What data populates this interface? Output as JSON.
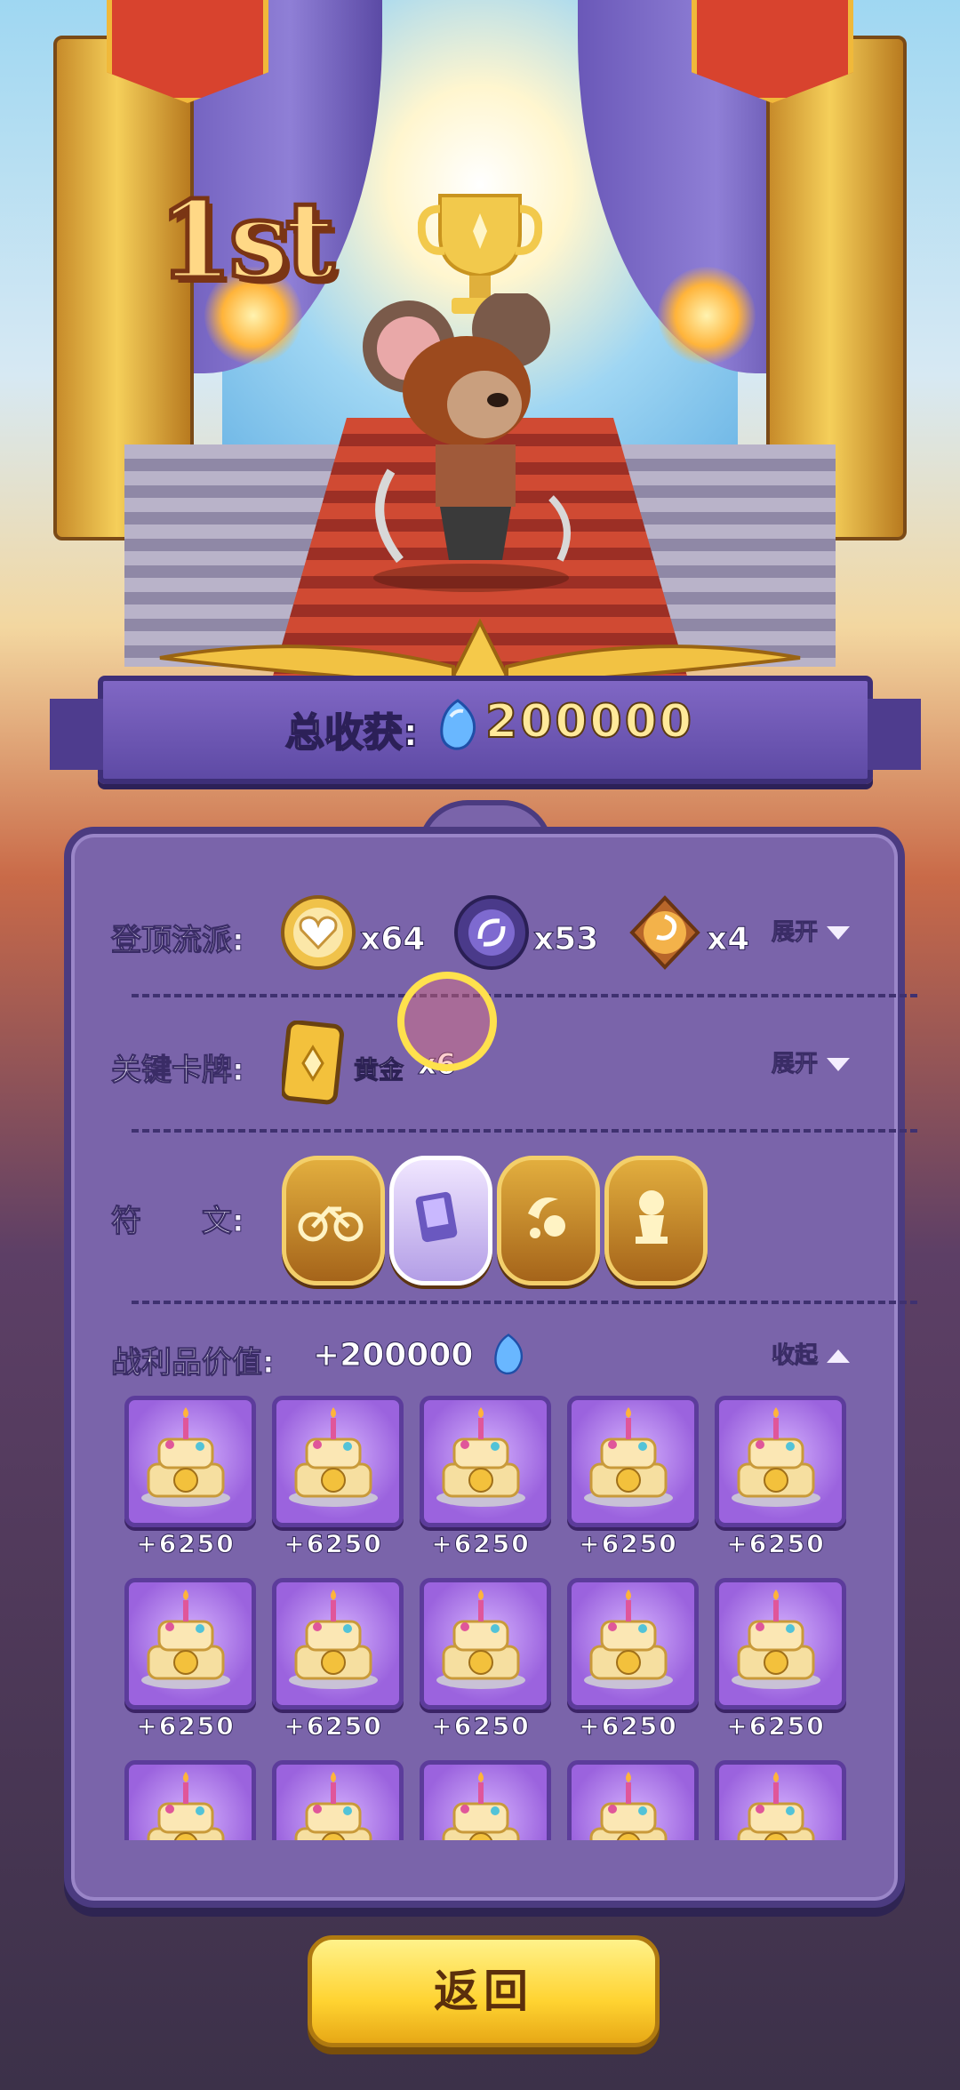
{
  "rank": "1st",
  "total": {
    "label": "总收获:",
    "value": "200000",
    "currency_icon": "blue-gem-icon"
  },
  "style_row": {
    "label": "登顶流派:",
    "items": [
      {
        "icon": "heart-coin-icon",
        "count": "x64"
      },
      {
        "icon": "swirl-orb-icon",
        "count": "x53"
      },
      {
        "icon": "tomoe-coin-icon",
        "count": "x4"
      }
    ],
    "toggle": "展开"
  },
  "card_row": {
    "label": "关键卡牌:",
    "card_name": "黄金",
    "card_count": "x6",
    "toggle": "展开"
  },
  "rune_row": {
    "label": "符　　文:",
    "runes": [
      "motorcycle-rune-icon",
      "card-rune-icon",
      "crescent-flower-rune-icon",
      "statue-rune-icon"
    ]
  },
  "loot_row": {
    "label": "战利品价值:",
    "value": "+200000",
    "toggle": "收起",
    "item_icon": "treasure-cake-icon",
    "item_values": [
      "+6250",
      "+6250",
      "+6250",
      "+6250",
      "+6250",
      "+6250",
      "+6250",
      "+6250",
      "+6250",
      "+6250"
    ]
  },
  "return_button": "返回",
  "colors": {
    "panel": "#7a64aa",
    "accent_gold": "#ffd331",
    "banner": "#5e4aa5"
  }
}
